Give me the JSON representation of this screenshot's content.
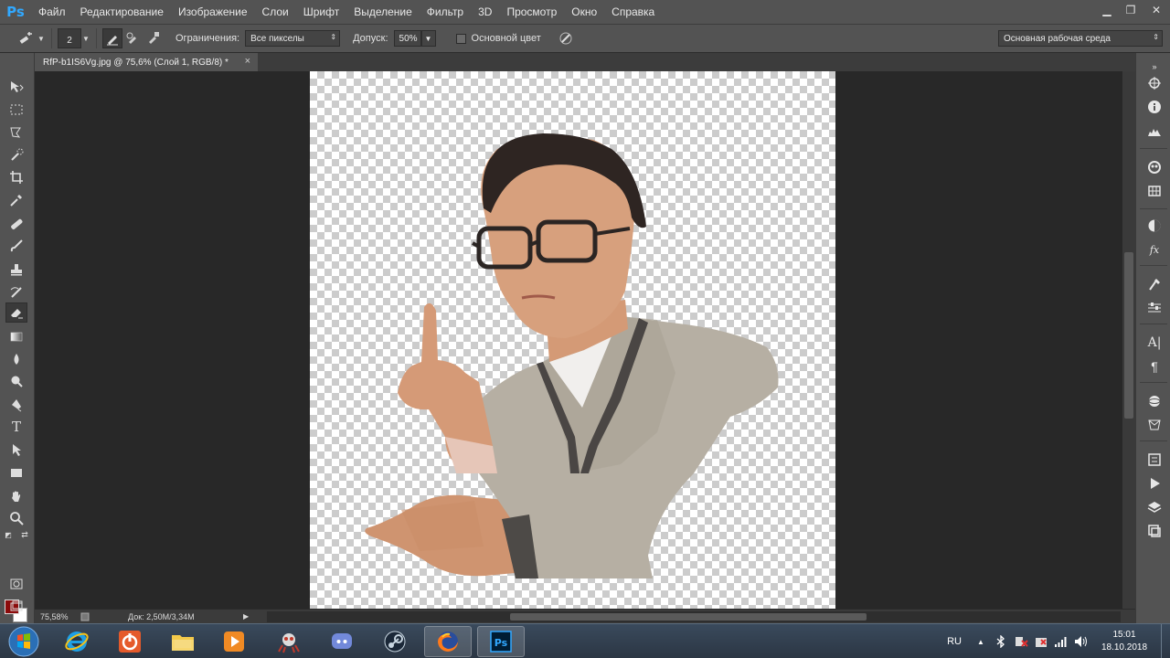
{
  "app": {
    "logo": "Ps"
  },
  "menu": [
    "Файл",
    "Редактирование",
    "Изображение",
    "Слои",
    "Шрифт",
    "Выделение",
    "Фильтр",
    "3D",
    "Просмотр",
    "Окно",
    "Справка"
  ],
  "window_controls": {
    "minimize": "▁",
    "maximize": "❐",
    "close": "✕"
  },
  "options": {
    "brush_size": "2",
    "limits_label": "Ограничения:",
    "limits_value": "Все пикселы",
    "tolerance_label": "Допуск:",
    "tolerance_value": "50%",
    "main_color_label": "Основной цвет",
    "workspace": "Основная рабочая среда"
  },
  "document": {
    "tab_title": "RfP-b1IS6Vg.jpg @ 75,6% (Слой 1, RGB/8) *",
    "close_glyph": "×"
  },
  "status": {
    "zoom": "75,58%",
    "doc_info": "Док: 2,50M/3,34M",
    "play_glyph": "▶"
  },
  "colors": {
    "foreground": "#8b0b0b",
    "background": "#ffffff",
    "ui_bg": "#535353",
    "canvas_bg": "#282828"
  },
  "toolbar_icons": [
    "move-icon",
    "marquee-icon",
    "lasso-icon",
    "quick-selection-icon",
    "crop-icon",
    "eyedropper-icon",
    "healing-brush-icon",
    "brush-icon",
    "clone-stamp-icon",
    "history-brush-icon",
    "eraser-icon",
    "gradient-icon",
    "blur-icon",
    "dodge-icon",
    "pen-icon",
    "type-icon",
    "path-selection-icon",
    "rectangle-icon",
    "hand-icon",
    "zoom-icon"
  ],
  "taskbar": {
    "apps": [
      "internet-explorer",
      "shutdown-app",
      "file-explorer",
      "media-player",
      "spider-app",
      "discord",
      "steam",
      "firefox",
      "photoshop"
    ],
    "lang": "RU",
    "time": "15:01",
    "date": "18.10.2018"
  }
}
